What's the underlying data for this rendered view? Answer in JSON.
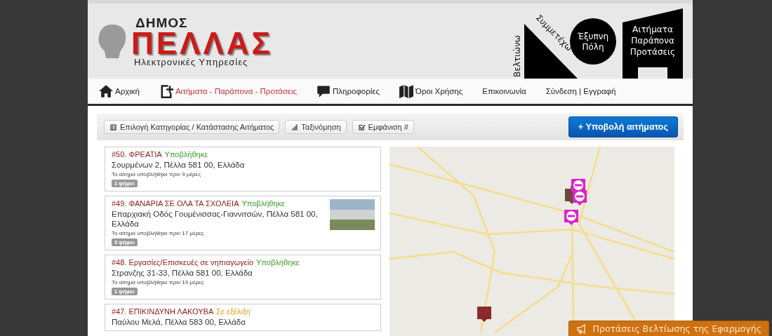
{
  "header": {
    "municipality_small": "ΔΗΜΟΣ",
    "municipality_large": "ΠΕΛΛΑΣ",
    "subtitle": "Ηλεκτρονικές Υπηρεσίες",
    "badge_vertical": "Βελτιώνω",
    "badge_diagonal": "Συμμετέχω",
    "badge_circle": [
      "Έξυπνη",
      "Πόλη"
    ],
    "badge_building": [
      "Αιτήματα",
      "Παράπονα",
      "Προτάσεις"
    ]
  },
  "nav": [
    {
      "label": "Αρχική",
      "selected": false
    },
    {
      "label": "Αιτήματα - Παράπονα - Προτάσεις",
      "selected": true
    },
    {
      "label": "Πληροφορίες",
      "selected": false
    },
    {
      "label": "Όροι Χρήσης",
      "selected": false
    },
    {
      "label": "Επικοινωνία",
      "selected": false
    },
    {
      "label": "Σύνδεση | Εγγραφή",
      "selected": false
    }
  ],
  "toolbar": {
    "buttons": [
      "Επιλογή Κατηγορίας / Κατάστασης Αιτήματος",
      "Ταξινόμηση",
      "Εμφάνιση #"
    ],
    "submit": "+ Υποβολή αιτήματος"
  },
  "requests": [
    {
      "title": "#50. ΦΡΕΑΤΙΑ",
      "status": "Υποβλήθηκε",
      "color": "#3a9a2a",
      "address": "Σουρμένων 2, Πέλλα 581 00, Ελλάδα",
      "time": "Το αίτημα υποβλήθηκε πριν 9 μέρες",
      "votes": "1 ψήφοι",
      "has_photo": false
    },
    {
      "title": "#49. ΦΑΝΑΡΙΑ ΣΕ ΟΛΑ ΤΑ ΣΧΟΛΕΙΑ",
      "status": "Υποβλήθηκε",
      "color": "#3a9a2a",
      "address": "Επαρχιακή Οδός Γουμένισσας-Γιαννιτσών, Πέλλα 581 00, Ελλάδα",
      "time": "Το αίτημα υποβλήθηκε πριν 17 μέρες",
      "votes": "3 ψήφοι",
      "has_photo": true
    },
    {
      "title": "#48. Εργασίες/Επισκευές σε νηπιαγωγείο",
      "status": "Υποβλήθηκε",
      "color": "#3a9a2a",
      "address": "Στρανζης 31-33, Πέλλα 581 00, Ελλάδα",
      "time": "Το αίτημα υποβλήθηκε πριν 19 μέρες",
      "votes": "1 ψήφοι",
      "has_photo": false
    },
    {
      "title": "#47. ΕΠΙΚΙΝΔΥΝΗ ΛΑΚΟΥΒΑ",
      "status": "Σε εξέλιξη",
      "color": "#e69a10",
      "address": "Παύλου Μελά, Πέλλα 583 00, Ελλάδα",
      "has_photo": false
    }
  ],
  "feedback": "Προτάσεις Βελτίωσης της Εφαρμογής"
}
